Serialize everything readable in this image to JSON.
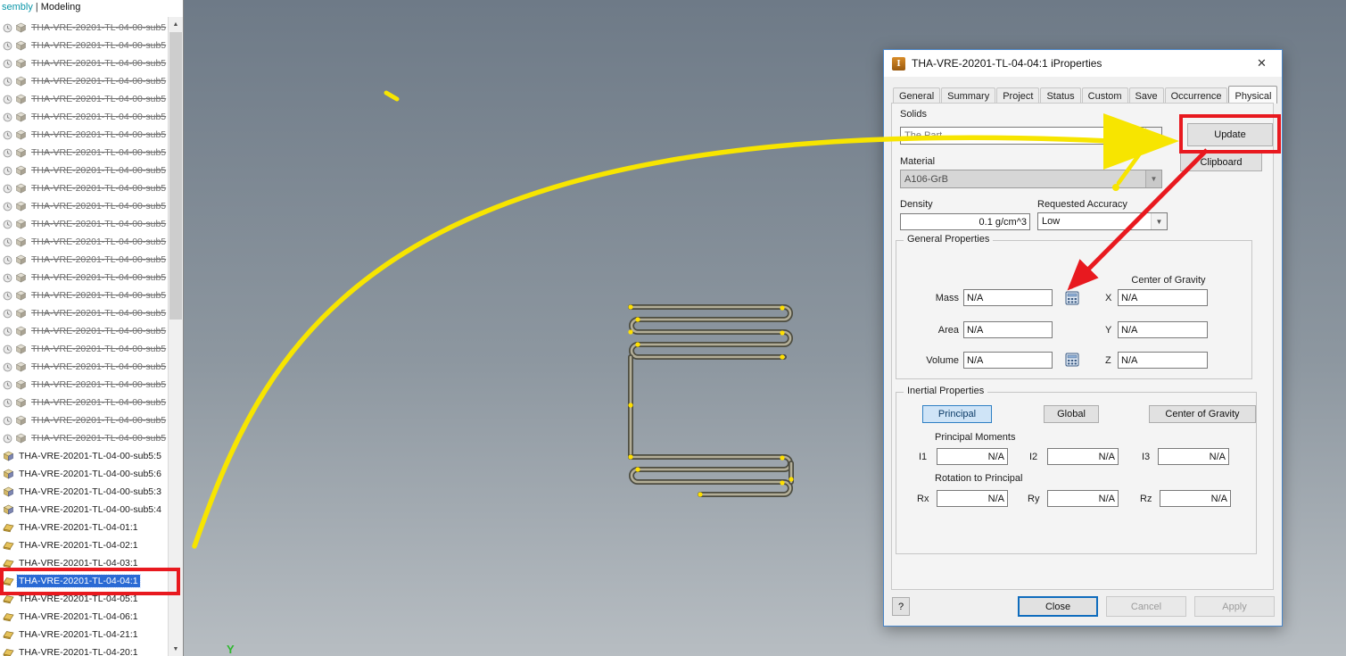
{
  "app": {
    "header_left": "sembly",
    "header_sep": "|",
    "header_right": "Modeling"
  },
  "tree": {
    "struck_items": [
      "THA-VRE-20201-TL-04-00-sub5",
      "THA-VRE-20201-TL-04-00-sub5",
      "THA-VRE-20201-TL-04-00-sub5",
      "THA-VRE-20201-TL-04-00-sub5",
      "THA-VRE-20201-TL-04-00-sub5",
      "THA-VRE-20201-TL-04-00-sub5",
      "THA-VRE-20201-TL-04-00-sub5",
      "THA-VRE-20201-TL-04-00-sub5",
      "THA-VRE-20201-TL-04-00-sub5",
      "THA-VRE-20201-TL-04-00-sub5",
      "THA-VRE-20201-TL-04-00-sub5",
      "THA-VRE-20201-TL-04-00-sub5",
      "THA-VRE-20201-TL-04-00-sub5",
      "THA-VRE-20201-TL-04-00-sub5",
      "THA-VRE-20201-TL-04-00-sub5",
      "THA-VRE-20201-TL-04-00-sub5",
      "THA-VRE-20201-TL-04-00-sub5",
      "THA-VRE-20201-TL-04-00-sub5",
      "THA-VRE-20201-TL-04-00-sub5",
      "THA-VRE-20201-TL-04-00-sub5",
      "THA-VRE-20201-TL-04-00-sub5",
      "THA-VRE-20201-TL-04-00-sub5",
      "THA-VRE-20201-TL-04-00-sub5",
      "THA-VRE-20201-TL-04-00-sub5"
    ],
    "sub_items": [
      "THA-VRE-20201-TL-04-00-sub5:5",
      "THA-VRE-20201-TL-04-00-sub5:6",
      "THA-VRE-20201-TL-04-00-sub5:3",
      "THA-VRE-20201-TL-04-00-sub5:4"
    ],
    "part_items": [
      "THA-VRE-20201-TL-04-01:1",
      "THA-VRE-20201-TL-04-02:1",
      "THA-VRE-20201-TL-04-03:1",
      "THA-VRE-20201-TL-04-04:1",
      "THA-VRE-20201-TL-04-05:1",
      "THA-VRE-20201-TL-04-06:1",
      "THA-VRE-20201-TL-04-21:1",
      "THA-VRE-20201-TL-04-20:1"
    ],
    "selected": "THA-VRE-20201-TL-04-04:1"
  },
  "viewport": {
    "axis_label": "Y"
  },
  "dialog": {
    "title": "THA-VRE-20201-TL-04-04:1 iProperties",
    "close_glyph": "✕",
    "tabs": [
      "General",
      "Summary",
      "Project",
      "Status",
      "Custom",
      "Save",
      "Occurrence",
      "Physical"
    ],
    "active_tab": "Physical",
    "solids_label": "Solids",
    "solids_value": "The Part",
    "update_button": "Update",
    "material_label": "Material",
    "material_value": "A106-GrB",
    "clipboard_button": "Clipboard",
    "density_label": "Density",
    "density_value": "0.1 g/cm^3",
    "accuracy_label": "Requested Accuracy",
    "accuracy_value": "Low",
    "general_properties": {
      "title": "General Properties",
      "cog_title": "Center of Gravity",
      "mass_label": "Mass",
      "mass_value": "N/A",
      "area_label": "Area",
      "area_value": "N/A",
      "volume_label": "Volume",
      "volume_value": "N/A",
      "x_label": "X",
      "x_value": "N/A",
      "y_label": "Y",
      "y_value": "N/A",
      "z_label": "Z",
      "z_value": "N/A"
    },
    "inertial_properties": {
      "title": "Inertial Properties",
      "principal_button": "Principal",
      "global_button": "Global",
      "cog_button": "Center of Gravity",
      "principal_moments_label": "Principal Moments",
      "i1_label": "I1",
      "i1_value": "N/A",
      "i2_label": "I2",
      "i2_value": "N/A",
      "i3_label": "I3",
      "i3_value": "N/A",
      "rotation_label": "Rotation to Principal",
      "rx_label": "Rx",
      "rx_value": "N/A",
      "ry_label": "Ry",
      "ry_value": "N/A",
      "rz_label": "Rz",
      "rz_value": "N/A"
    },
    "help_button": "?",
    "close_button": "Close",
    "cancel_button": "Cancel",
    "apply_button": "Apply"
  },
  "annotations": {
    "highlight_color": "#e8191f",
    "arrow_color": "#f7e500"
  }
}
